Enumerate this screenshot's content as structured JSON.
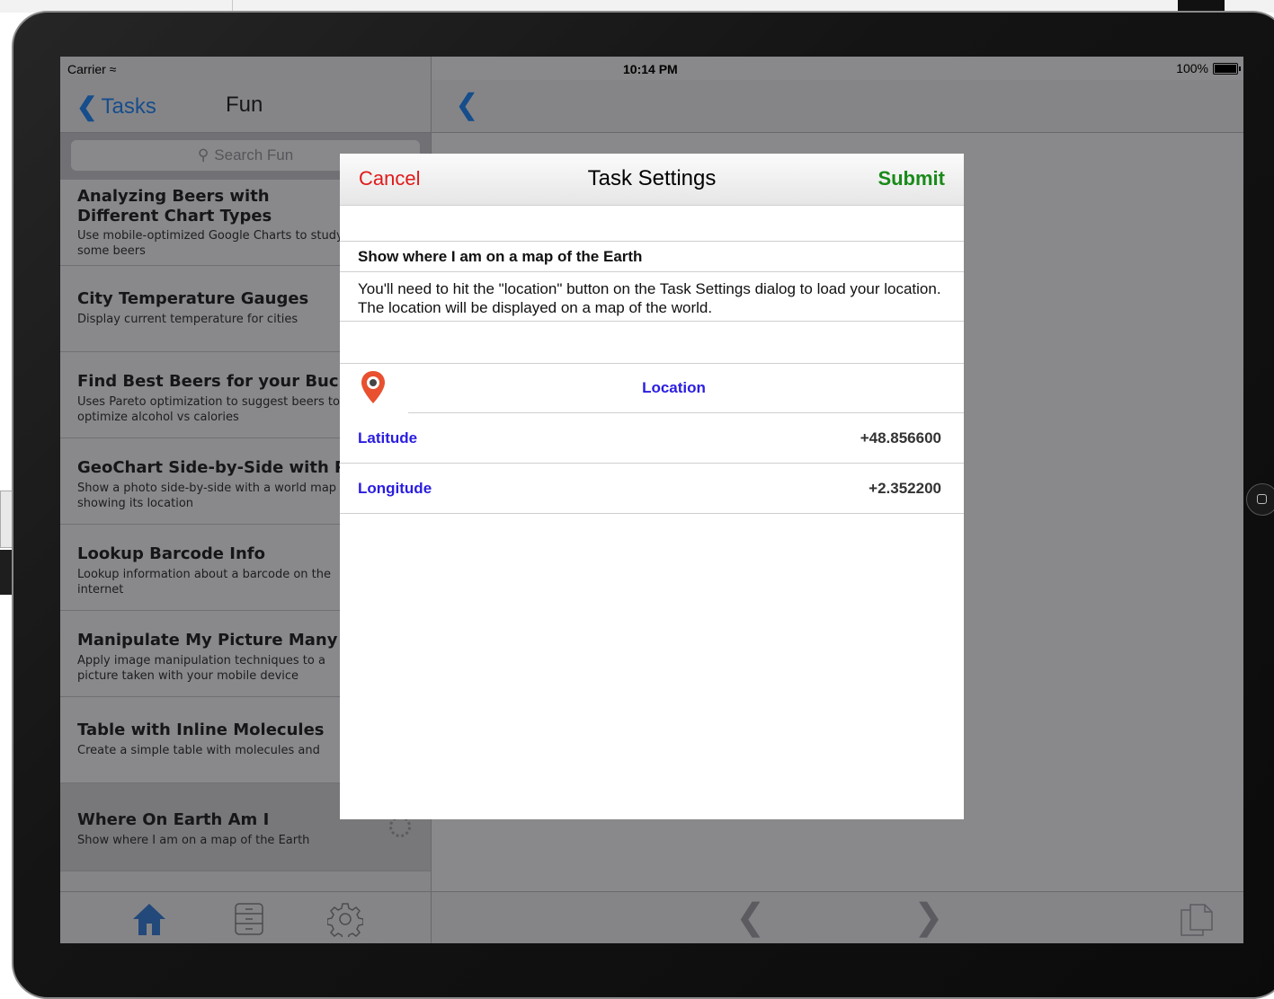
{
  "status": {
    "carrier": "Carrier",
    "time": "10:14 PM",
    "battery": "100%"
  },
  "master": {
    "back_label": "Tasks",
    "title": "Fun",
    "search_placeholder": "Search Fun",
    "items": [
      {
        "title": "Analyzing Beers with Different Chart Types",
        "desc": "Use mobile-optimized Google Charts to study some beers"
      },
      {
        "title": "City Temperature Gauges",
        "desc": "Display current temperature for cities"
      },
      {
        "title": "Find Best Beers for your Buck",
        "desc": "Uses Pareto optimization to suggest beers to optimize alcohol vs calories"
      },
      {
        "title": "GeoChart Side-by-Side with Photo",
        "desc": "Show a photo side-by-side with a world map showing its location"
      },
      {
        "title": "Lookup Barcode Info",
        "desc": "Lookup information about a barcode on the internet"
      },
      {
        "title": "Manipulate My Picture Many Ways",
        "desc": "Apply image manipulation techniques to a picture taken with your mobile device"
      },
      {
        "title": "Table with Inline Molecules",
        "desc": "Create a simple table with molecules and"
      },
      {
        "title": "Where On Earth Am I",
        "desc": "Show where I am on a map of the Earth"
      }
    ],
    "tabs": [
      "home-icon",
      "list-icon",
      "settings-icon"
    ]
  },
  "detail": {
    "toolbar": [
      "back-arrow-icon",
      "forward-arrow-icon",
      "copy-icon"
    ]
  },
  "modal": {
    "cancel_label": "Cancel",
    "title": "Task Settings",
    "submit_label": "Submit",
    "section_title": "Show where I am on a map of the Earth",
    "description": "You'll need to hit the \"location\" button on the Task Settings dialog to load your location. The location will be displayed on a map of the world.",
    "location_label": "Location",
    "latitude_label": "Latitude",
    "latitude_value": "+48.856600",
    "longitude_label": "Longitude",
    "longitude_value": "+2.352200"
  },
  "colors": {
    "ios_blue": "#007aff",
    "cancel_red": "#e01a1a",
    "submit_green": "#1a8a1a",
    "field_blue": "#2a1de0"
  }
}
